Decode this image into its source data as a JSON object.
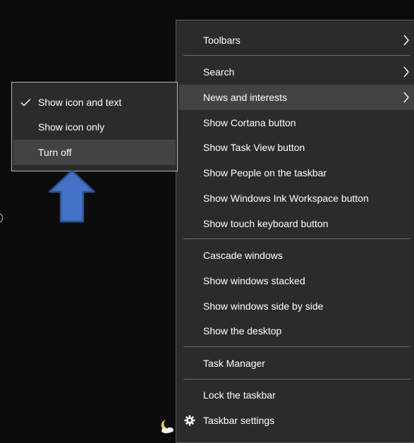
{
  "main_menu": {
    "items": [
      {
        "label": "Toolbars",
        "has_submenu": true
      },
      {
        "label": "Search",
        "has_submenu": true
      },
      {
        "label": "News and interests",
        "has_submenu": true,
        "highlighted": true
      },
      {
        "label": "Show Cortana button"
      },
      {
        "label": "Show Task View button"
      },
      {
        "label": "Show People on the taskbar"
      },
      {
        "label": "Show Windows Ink Workspace button"
      },
      {
        "label": "Show touch keyboard button"
      },
      {
        "label": "Cascade windows"
      },
      {
        "label": "Show windows stacked"
      },
      {
        "label": "Show windows side by side"
      },
      {
        "label": "Show the desktop"
      },
      {
        "label": "Task Manager"
      },
      {
        "label": "Lock the taskbar"
      },
      {
        "label": "Taskbar settings",
        "icon": "gear-icon"
      }
    ]
  },
  "sub_menu": {
    "items": [
      {
        "label": "Show icon and text",
        "checked": true
      },
      {
        "label": "Show icon only"
      },
      {
        "label": "Turn off",
        "highlighted": true
      }
    ]
  },
  "annotation": {
    "icon": "arrow-up-icon",
    "fill": "#4472c4",
    "stroke": "#2f4f8f"
  },
  "colors": {
    "background": "#0b0b0b",
    "menu_background": "#2b2b2b",
    "highlight": "#434343",
    "separator": "#6b6b6b",
    "text": "#ffffff"
  },
  "taskbar": {
    "weather_icon": "moon-cloud-icon"
  }
}
